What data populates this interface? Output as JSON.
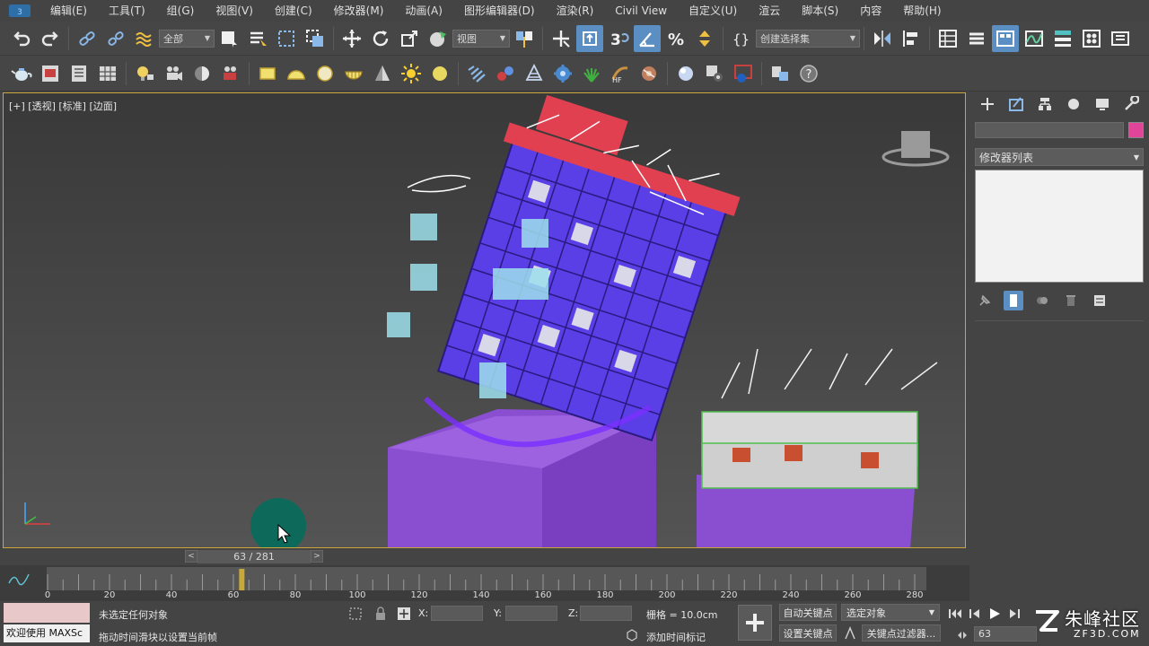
{
  "menubar": {
    "items": [
      "编辑(E)",
      "工具(T)",
      "组(G)",
      "视图(V)",
      "创建(C)",
      "修改器(M)",
      "动画(A)",
      "图形编辑器(D)",
      "渲染(R)",
      "Civil View",
      "自定义(U)",
      "渲云",
      "脚本(S)",
      "内容",
      "帮助(H)"
    ]
  },
  "toolbar1": {
    "selection_filter": "全部",
    "ref_coord": "视图",
    "named_selection": "创建选择集"
  },
  "toolbar2": {
    "icons": [
      "teapot-icon",
      "render-frame-icon",
      "list-icon",
      "grid-panel-icon",
      "light-bulb-icon",
      "camera-icon",
      "sphere-half-icon",
      "film-camera-icon",
      "box-icon",
      "dome-icon",
      "circle-icon",
      "bowl-icon",
      "cone-icon",
      "sun-icon",
      "disc-icon",
      "particle-icon",
      "molecule-icon",
      "plane-icon",
      "gear-sphere-icon",
      "grass-icon",
      "hair-icon",
      "tape-icon",
      "material-sphere-icon",
      "render-setup-icon",
      "teapot-render-icon",
      "layers-icon",
      "help-icon"
    ]
  },
  "viewport": {
    "label": "[+] [透视] [标准] [边面]",
    "accent": "#c9a53a"
  },
  "command_panel": {
    "modifier_list": "修改器列表",
    "object_color": "#e0459a",
    "tabs": [
      "create-tab-icon",
      "modify-tab-icon",
      "hierarchy-tab-icon",
      "motion-tab-icon",
      "display-tab-icon",
      "utilities-tab-icon"
    ]
  },
  "timeline": {
    "frame_display": "63 / 281",
    "prev": "<",
    "next": ">",
    "current_frame": 63,
    "total_frames": 281,
    "ticks": [
      "0",
      "20",
      "40",
      "60",
      "80",
      "100",
      "120",
      "140",
      "160",
      "180",
      "200",
      "220",
      "240",
      "260",
      "280"
    ]
  },
  "statusbar": {
    "maxscript_label": "欢迎使用 MAXSc",
    "status_text": "未选定任何对象",
    "prompt_text": "拖动时间滑块以设置当前帧",
    "x_label": "X:",
    "y_label": "Y:",
    "z_label": "Z:",
    "grid": "栅格 = 10.0cm",
    "add_time_tag": "添加时间标记",
    "auto_key": "自动关键点",
    "set_key": "设置关键点",
    "selected_object": "选定对象",
    "key_filters": "关键点过滤器...",
    "frame_value": "63"
  },
  "watermark": {
    "brand": "朱峰社区",
    "site": "ZF3D.COM"
  }
}
